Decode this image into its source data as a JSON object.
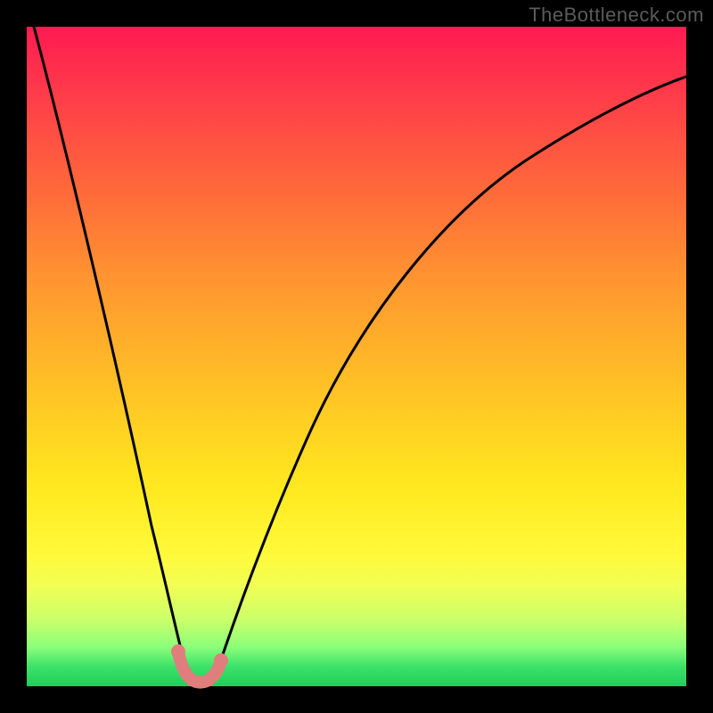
{
  "watermark": "TheBottleneck.com",
  "chart_data": {
    "type": "line",
    "title": "",
    "xlabel": "",
    "ylabel": "",
    "xlim": [
      0,
      100
    ],
    "ylim": [
      0,
      100
    ],
    "series": [
      {
        "name": "bottleneck-curve",
        "x": [
          0,
          5,
          10,
          15,
          18,
          20,
          22,
          24,
          26,
          28,
          30,
          32,
          35,
          40,
          45,
          50,
          55,
          60,
          65,
          70,
          75,
          80,
          85,
          90,
          95,
          100
        ],
        "y": [
          100,
          78,
          56,
          34,
          20,
          12,
          5,
          0,
          0,
          2,
          6,
          10,
          17,
          27,
          36,
          44,
          51,
          57,
          62,
          67,
          71,
          74,
          77,
          79,
          81,
          83
        ]
      },
      {
        "name": "min-marker",
        "x": [
          22,
          23,
          24,
          25,
          26,
          27,
          28
        ],
        "y": [
          3.5,
          1.2,
          0.3,
          0.0,
          0.3,
          1.5,
          3.2
        ]
      }
    ],
    "colors": {
      "curve": "#000000",
      "marker": "#e07d7d",
      "gradient_top": "#ff1a52",
      "gradient_mid": "#ffe91f",
      "gradient_bottom": "#1ecf5a"
    }
  }
}
